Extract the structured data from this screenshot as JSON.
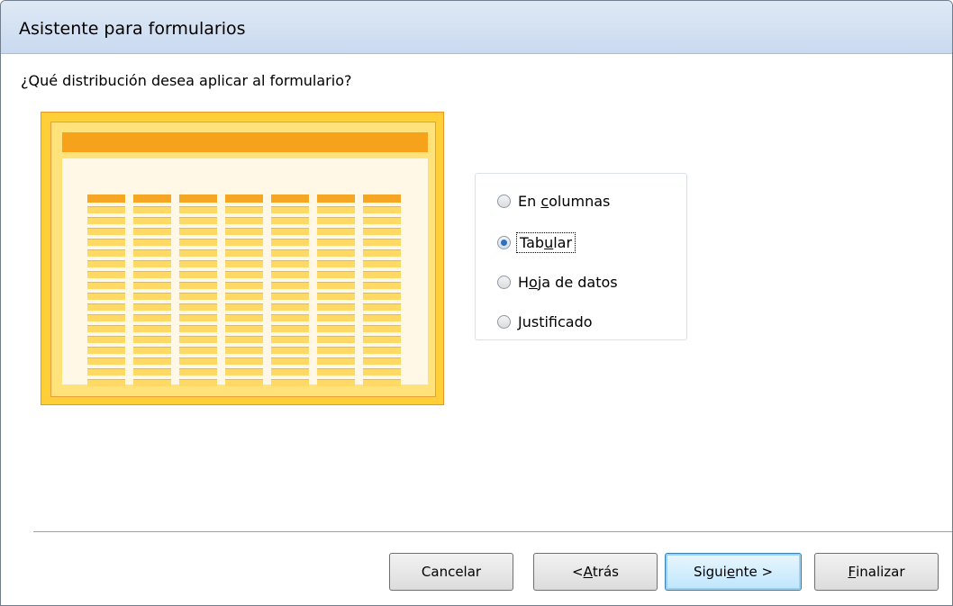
{
  "window": {
    "title": "Asistente para formularios"
  },
  "question": "¿Qué distribución desea aplicar al formulario?",
  "options": {
    "columnas": {
      "pre": "En ",
      "mn": "c",
      "post": "olumnas"
    },
    "tabular": {
      "pre": "Tab",
      "mn": "u",
      "post": "lar",
      "selected": true
    },
    "hoja": {
      "pre": "H",
      "mn": "o",
      "post": "ja de datos"
    },
    "justificado": {
      "pre": "",
      "mn": "J",
      "post": "ustificado"
    }
  },
  "buttons": {
    "cancelar": {
      "pre": "Cancelar",
      "mn": "",
      "post": ""
    },
    "atras": {
      "pre": "< ",
      "mn": "A",
      "post": "trás"
    },
    "siguiente": {
      "pre": "Sigui",
      "mn": "e",
      "post": "nte >"
    },
    "finalizar": {
      "pre": "",
      "mn": "F",
      "post": "inalizar"
    }
  },
  "colors": {
    "accent": "#f7a21b",
    "preview_border": "#e8962a",
    "selected_radio": "#2a6fc9"
  }
}
